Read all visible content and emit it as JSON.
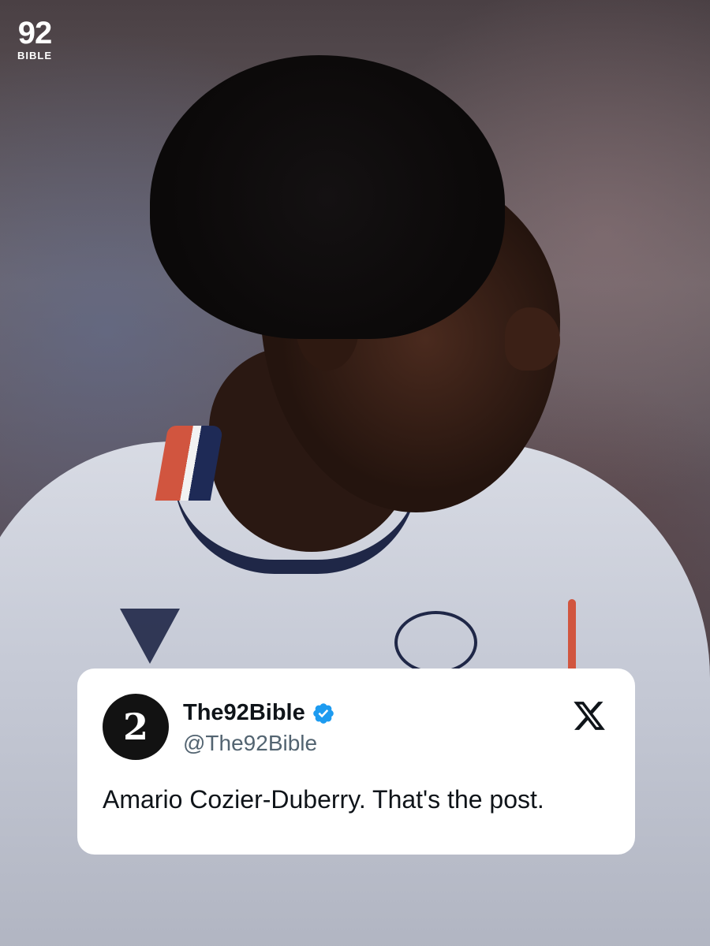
{
  "logo": {
    "number": "92",
    "word": "BIBLE"
  },
  "tweet": {
    "avatar_glyph": "2",
    "display_name": "The92Bible",
    "handle": "@The92Bible",
    "verified_icon": "verified-badge-icon",
    "platform_icon": "x-logo-icon",
    "text": "Amario Cozier-Duberry. That's the post."
  },
  "colors": {
    "verified_blue": "#1d9bf0",
    "card_background": "#ffffff",
    "kit_red": "#d1553f",
    "kit_navy": "#1f2747"
  }
}
